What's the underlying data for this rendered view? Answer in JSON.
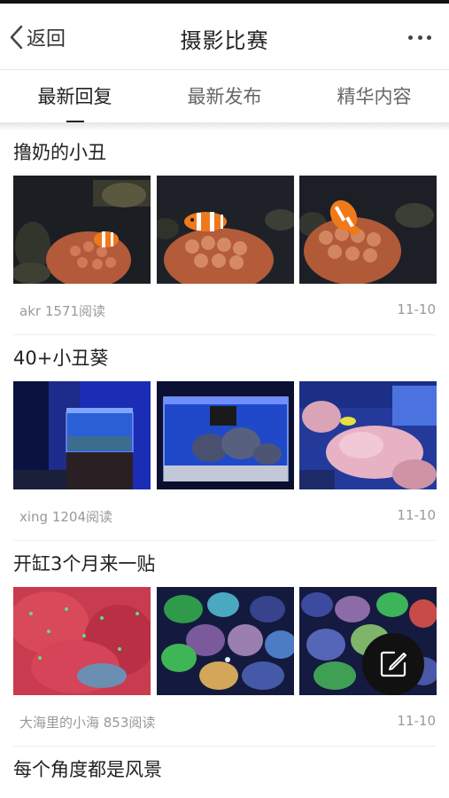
{
  "header": {
    "back_label": "返回",
    "title": "摄影比赛",
    "more_icon": "more-horizontal-icon"
  },
  "tabs": [
    {
      "label": "最新回复",
      "active": true
    },
    {
      "label": "最新发布",
      "active": false
    },
    {
      "label": "精华内容",
      "active": false
    }
  ],
  "posts": [
    {
      "title": "撸奶的小丑",
      "author": "akr 1571阅读",
      "date": "11-10"
    },
    {
      "title": "40+小丑葵",
      "author": "xing 1204阅读",
      "date": "11-10"
    },
    {
      "title": "开缸3个月来一贴",
      "author": "大海里的小海 853阅读",
      "date": "11-10"
    },
    {
      "title": "每个角度都是风景"
    }
  ],
  "fab": {
    "icon": "compose-icon"
  },
  "colors": {
    "accent": "#222222",
    "muted": "#999999",
    "fab": "#111111"
  }
}
